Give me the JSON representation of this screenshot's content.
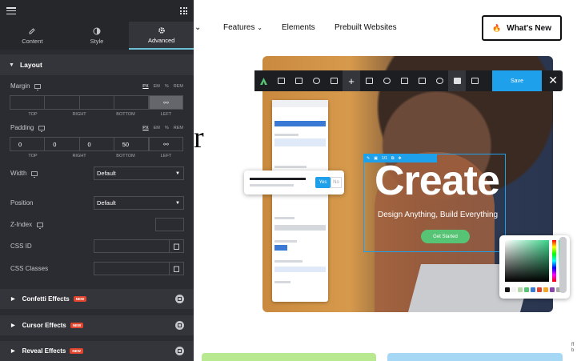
{
  "panel": {
    "tabs": [
      {
        "label": "Content",
        "icon": "pencil-icon"
      },
      {
        "label": "Style",
        "icon": "half-circle-icon"
      },
      {
        "label": "Advanced",
        "icon": "gear-icon"
      }
    ],
    "section_title": "Layout",
    "margin": {
      "label": "Margin",
      "units": [
        "PX",
        "EM",
        "%",
        "REM"
      ],
      "values": [
        "",
        "",
        "",
        ""
      ],
      "sides": [
        "TOP",
        "RIGHT",
        "BOTTOM",
        "LEFT"
      ]
    },
    "padding": {
      "label": "Padding",
      "units": [
        "PX",
        "EM",
        "%",
        "REM"
      ],
      "values": [
        "0",
        "0",
        "0",
        "50"
      ],
      "sides": [
        "TOP",
        "RIGHT",
        "BOTTOM",
        "LEFT"
      ]
    },
    "width": {
      "label": "Width",
      "value": "Default"
    },
    "position": {
      "label": "Position",
      "value": "Default"
    },
    "z_index": {
      "label": "Z-Index"
    },
    "css_id": {
      "label": "CSS ID"
    },
    "css_classes": {
      "label": "CSS Classes"
    },
    "effects": [
      {
        "label": "Confetti Effects",
        "badge": "NEW"
      },
      {
        "label": "Cursor Effects",
        "badge": "NEW"
      },
      {
        "label": "Reveal Effects",
        "badge": "NEW"
      }
    ]
  },
  "site": {
    "nav": [
      "Features",
      "Elements",
      "Prebuilt Websites"
    ],
    "whats_new": "What's New",
    "hero": {
      "headline": "Create",
      "tagline": "Design Anything, Build Everything",
      "cta": "Get Started"
    },
    "editor": {
      "save_label": "Save",
      "breadcrumb": "1/1"
    },
    "confirm": {
      "yes": "Yes",
      "no": "No"
    }
  },
  "colors": {
    "panel_bg": "#2b2c31",
    "accent": "#1ea0ea",
    "badge": "#e2452e",
    "cta_green": "#56c474"
  }
}
